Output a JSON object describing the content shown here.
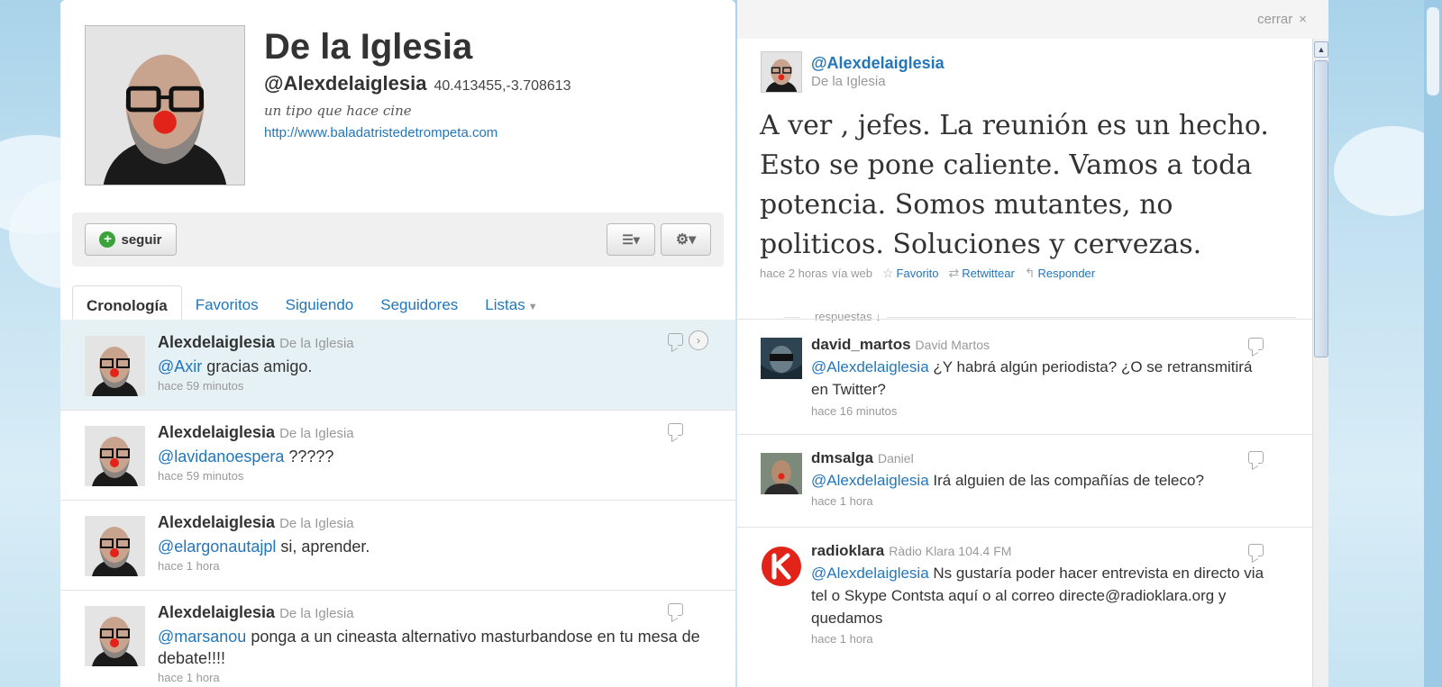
{
  "profile": {
    "name": "De la Iglesia",
    "handle": "@Alexdelaiglesia",
    "location": "40.413455,-3.708613",
    "bio": "un tipo que hace cine",
    "url": "http://www.baladatristedetrompeta.com"
  },
  "actions": {
    "follow_label": "seguir",
    "list_icon": "list-icon",
    "gear_icon": "gear-icon"
  },
  "tabs": [
    {
      "label": "Cronología",
      "active": true
    },
    {
      "label": "Favoritos"
    },
    {
      "label": "Siguiendo"
    },
    {
      "label": "Seguidores"
    },
    {
      "label": "Listas"
    }
  ],
  "timeline": [
    {
      "user": "Alexdelaiglesia",
      "realname": "De la Iglesia",
      "mention": "@Axir",
      "text": " gracias amigo.",
      "time": "hace 59 minutos"
    },
    {
      "user": "Alexdelaiglesia",
      "realname": "De la Iglesia",
      "mention": "@lavidanoespera",
      "text": " ?????",
      "time": "hace 59 minutos"
    },
    {
      "user": "Alexdelaiglesia",
      "realname": "De la Iglesia",
      "mention": "@elargonautajpl",
      "text": " si, aprender.",
      "time": "hace 1 hora"
    },
    {
      "user": "Alexdelaiglesia",
      "realname": "De la Iglesia",
      "mention": "@marsanou",
      "text": " ponga a un cineasta alternativo masturbandose en tu mesa de debate!!!!",
      "time": "hace 1 hora"
    }
  ],
  "detail": {
    "close_label": "cerrar",
    "close_icon": "×",
    "handle": "@Alexdelaiglesia",
    "realname": "De la Iglesia",
    "text": "A ver , jefes. La reunión es un hecho. Esto se pone caliente. Vamos a toda potencia. Somos mutantes, no politicos. Soluciones y cervezas.",
    "time": "hace 2 horas",
    "via": "vía web",
    "favorite": "Favorito",
    "retweet": "Retwittear",
    "reply": "Responder",
    "replies_label": "respuestas ↓"
  },
  "replies": [
    {
      "user": "david_martos",
      "realname": "David Martos",
      "mention": "@Alexdelaiglesia",
      "text": " ¿Y habrá algún periodista? ¿O se retransmitirá en Twitter?",
      "time": "hace 16 minutos"
    },
    {
      "user": "dmsalga",
      "realname": "Daniel",
      "mention": "@Alexdelaiglesia",
      "text": " Irá alguien de las compañías de teleco?",
      "time": "hace 1 hora"
    },
    {
      "user": "radioklara",
      "realname": "Ràdio Klara 104.4 FM",
      "mention": "@Alexdelaiglesia",
      "text": " Ns gustaría poder hacer entrevista en directo via tel o Skype Contsta aquí o al correo directe@radioklara.org y quedamos",
      "time": "hace 1 hora"
    }
  ],
  "colors": {
    "link": "#2276bb",
    "highlight": "#e6f1f6",
    "follow_plus": "#3aa23a",
    "radioklara_red": "#e2231a"
  }
}
